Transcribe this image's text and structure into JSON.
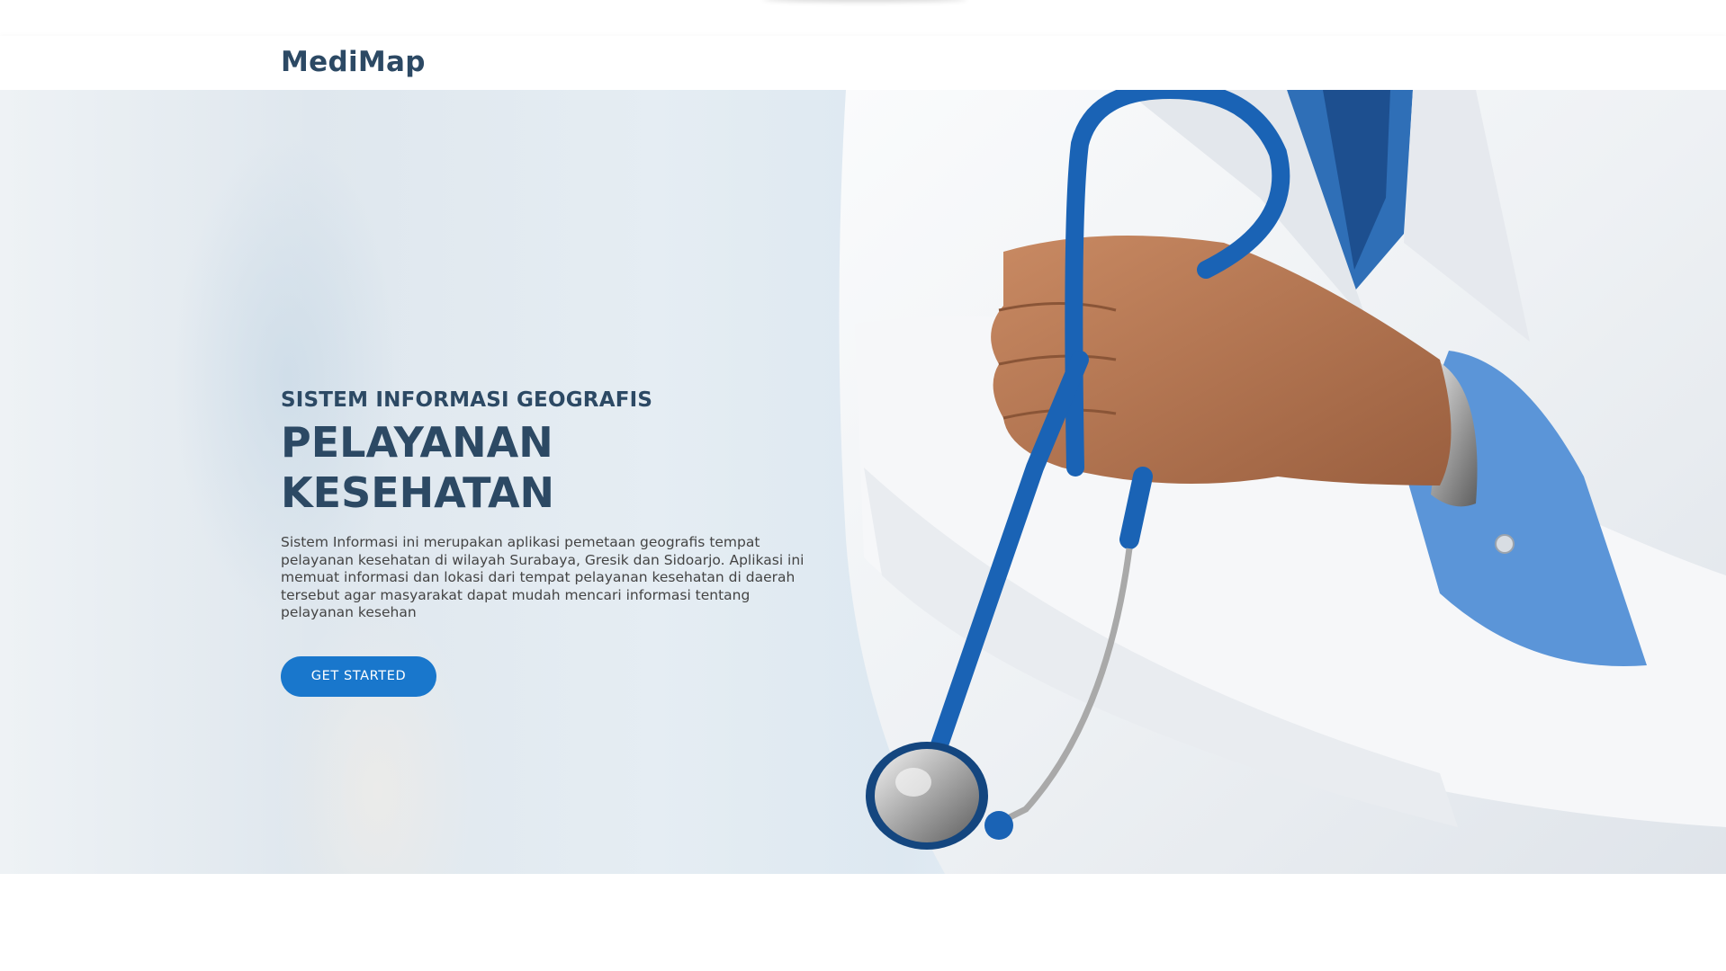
{
  "header": {
    "logo": "MediMap"
  },
  "hero": {
    "subtitle": "SISTEM INFORMASI GEOGRAFIS",
    "title": "PELAYANAN KESEHATAN",
    "description": "Sistem Informasi ini merupakan aplikasi pemetaan geografis tempat pelayanan kesehatan di wilayah Surabaya, Gresik dan Sidoarjo. Aplikasi ini memuat informasi dan lokasi dari tempat pelayanan kesehatan di daerah tersebut agar masyarakat dapat mudah mencari informasi tentang pelayanan kesehan",
    "cta_label": "GET STARTED"
  },
  "colors": {
    "brand": "#2c4964",
    "accent": "#1977cc"
  }
}
